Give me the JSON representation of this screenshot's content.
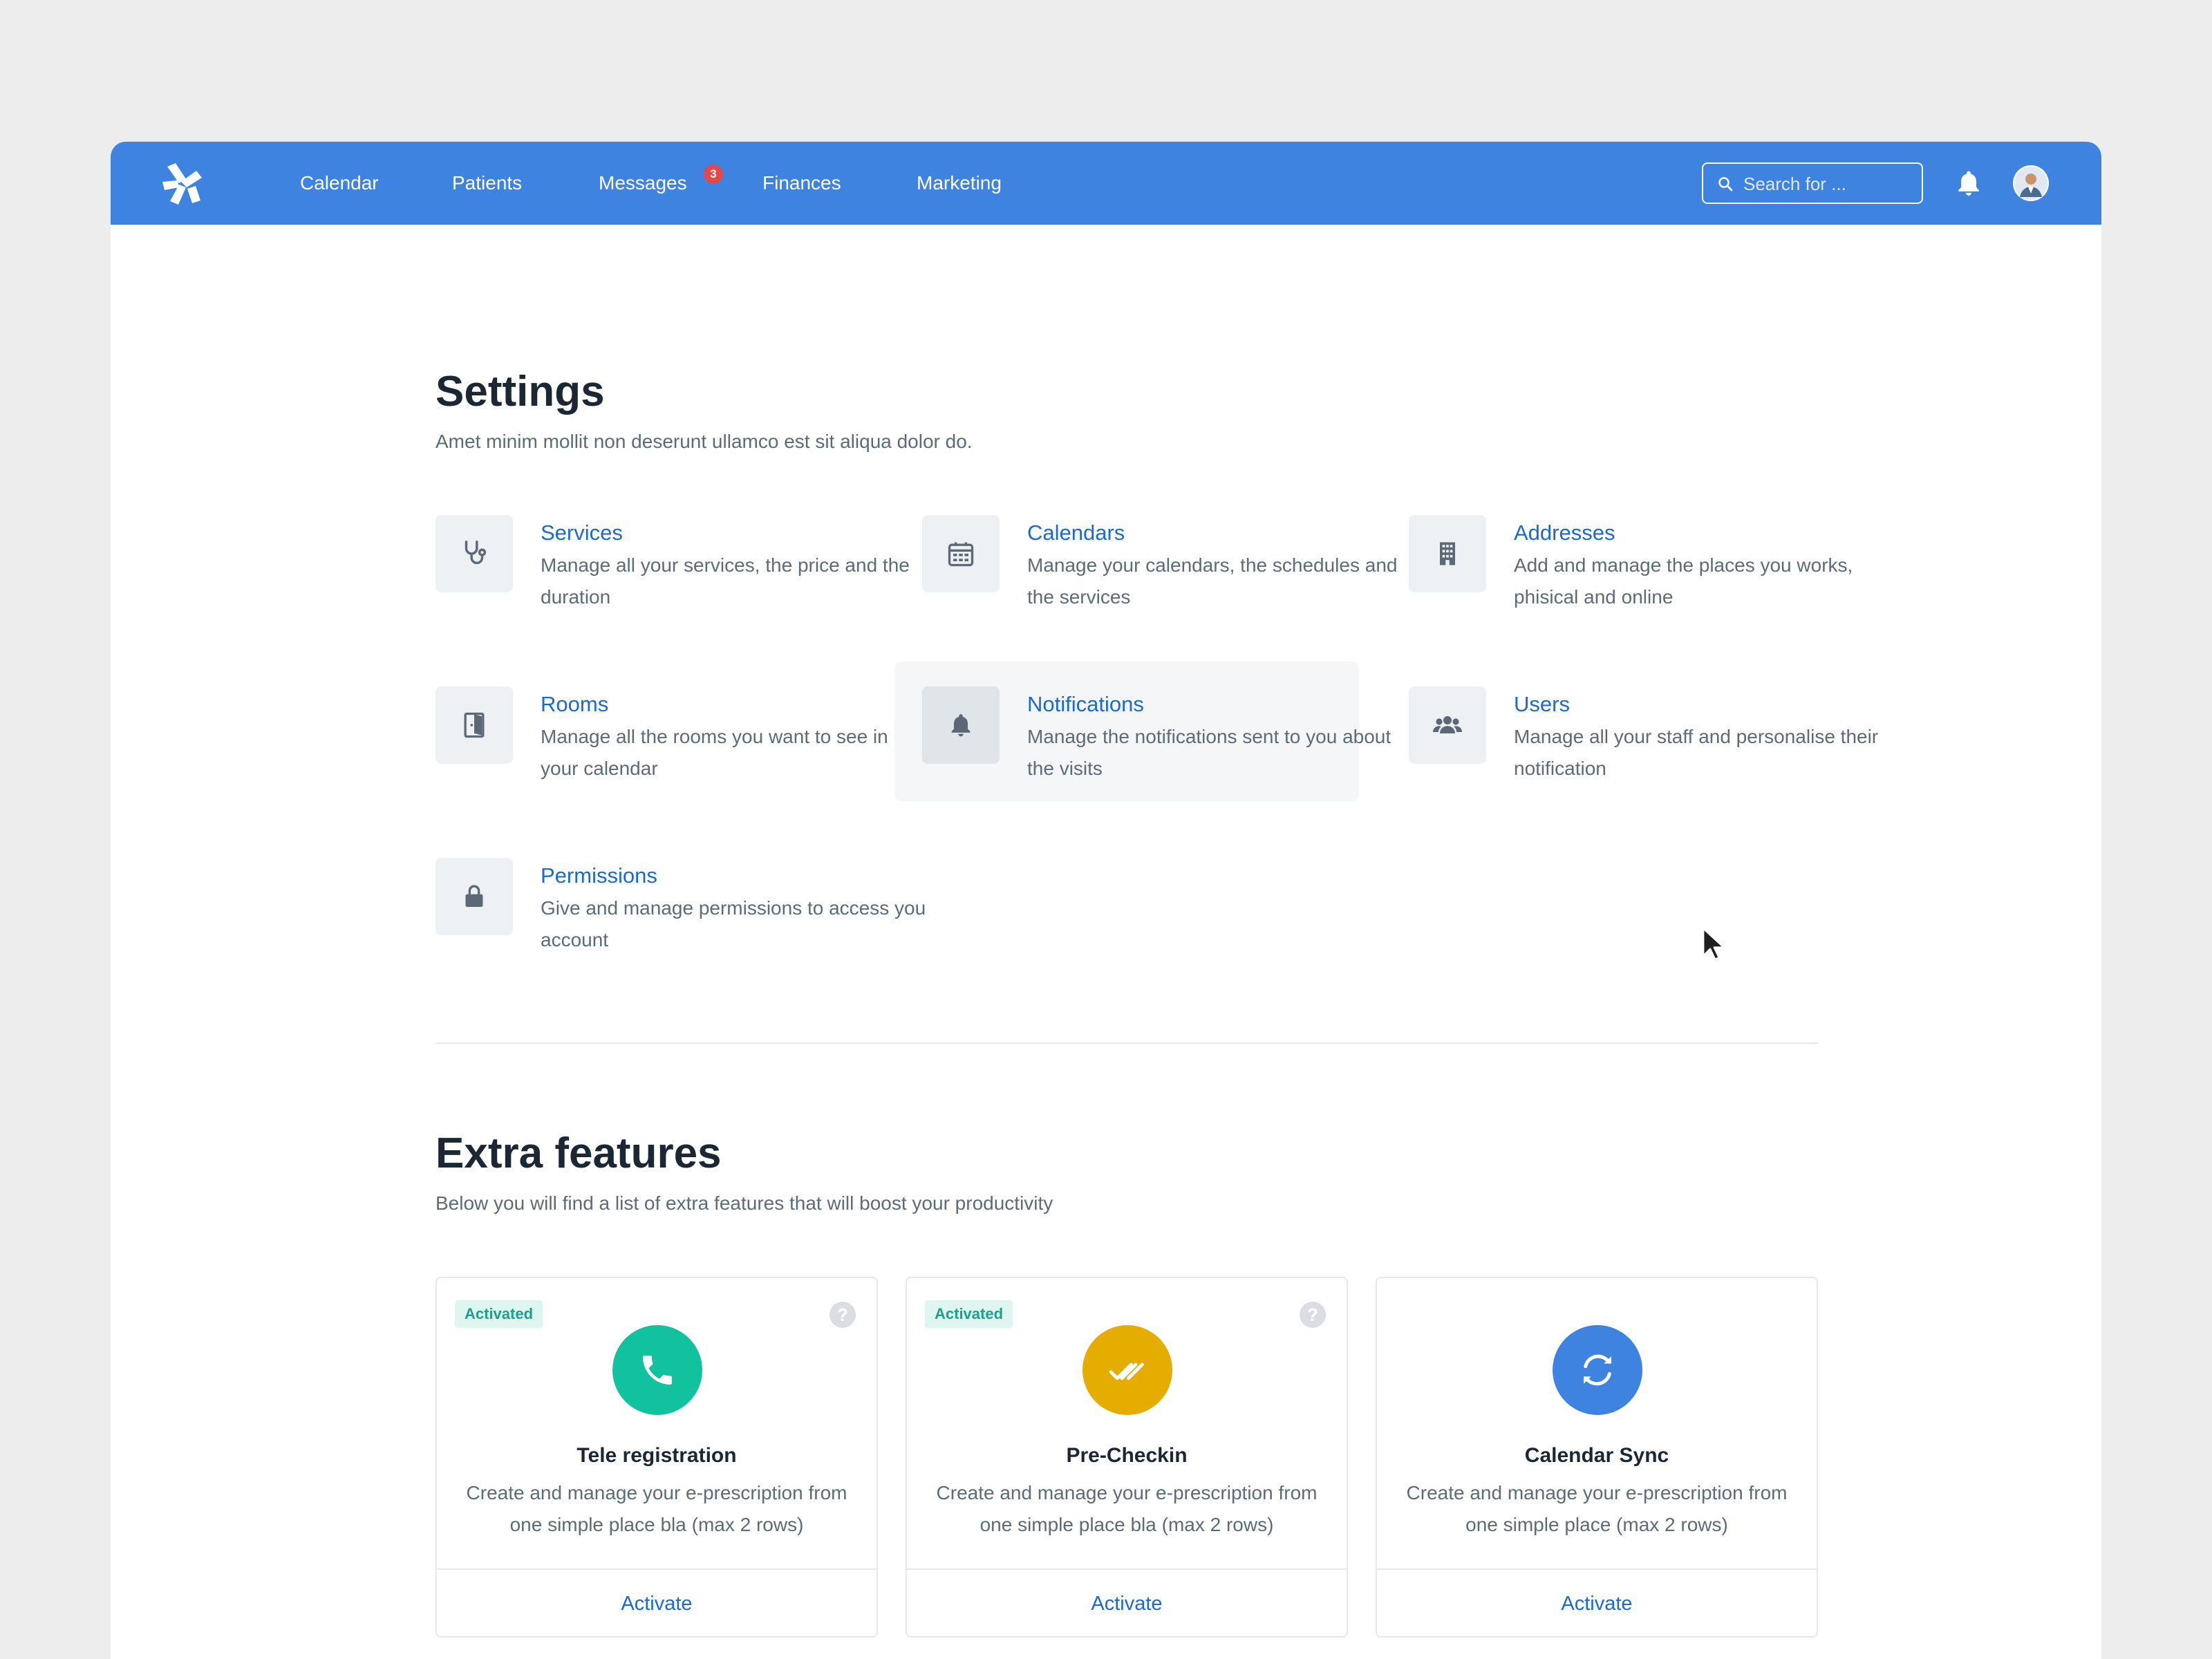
{
  "colors": {
    "nav_background": "#3f83e0",
    "link_blue": "#1b6ad2",
    "activated_green": "#1aa38a",
    "badge_red": "#e54848"
  },
  "nav": {
    "items": [
      {
        "label": "Calendar"
      },
      {
        "label": "Patients"
      },
      {
        "label": "Messages",
        "badge": "3"
      },
      {
        "label": "Finances"
      },
      {
        "label": "Marketing"
      }
    ],
    "search_placeholder": "Search for ...",
    "icons": {
      "logo": "docplanner-logo-icon",
      "notifications": "bell-icon",
      "profile": "avatar"
    }
  },
  "settings": {
    "title": "Settings",
    "subtitle": "Amet minim mollit non deserunt ullamco est sit aliqua dolor do.",
    "items": [
      {
        "title": "Services",
        "description": "Manage all your services, the price and the duration",
        "icon": "stethoscope-icon"
      },
      {
        "title": "Calendars",
        "description": "Manage your calendars, the schedules and the services",
        "icon": "calendar-icon"
      },
      {
        "title": "Addresses",
        "description": "Add and manage the places you works, phisical and online",
        "icon": "building-icon"
      },
      {
        "title": "Rooms",
        "description": "Manage all the rooms you want to see in your calendar",
        "icon": "door-icon"
      },
      {
        "title": "Notifications",
        "description": "Manage the notifications sent to you about the visits",
        "icon": "bell-icon"
      },
      {
        "title": "Users",
        "description": "Manage all your staff and personalise their notification",
        "icon": "users-icon"
      },
      {
        "title": "Permissions",
        "description": "Give and manage permissions to access you account",
        "icon": "lock-icon"
      }
    ]
  },
  "extra_features": {
    "title": "Extra features",
    "subtitle": "Below you will find a list of extra features that will boost your productivity",
    "cards": [
      {
        "badge": "Activated",
        "title": "Tele registration",
        "description": "Create and manage your e-prescription from one simple place bla (max 2 rows)",
        "action": "Activate",
        "icon": "phone-icon",
        "color": "#12c29f"
      },
      {
        "badge": "Activated",
        "title": "Pre-Checkin",
        "description": "Create and manage your e-prescription from one simple place bla (max 2 rows)",
        "action": "Activate",
        "icon": "double-check-icon",
        "color": "#e4ad00"
      },
      {
        "title": "Calendar Sync",
        "description": "Create and manage your e-prescription from one simple place (max 2 rows)",
        "action": "Activate",
        "icon": "sync-icon",
        "color": "#3f83e0"
      }
    ]
  }
}
